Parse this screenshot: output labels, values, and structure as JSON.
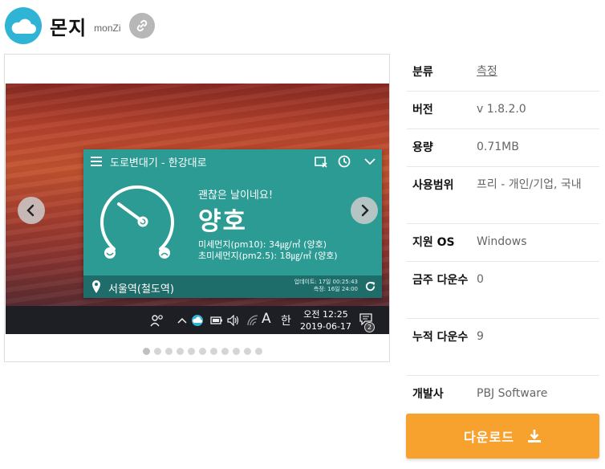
{
  "app": {
    "name": "몬지",
    "alt_name": "monZi"
  },
  "icons": {
    "logo": "cloud-logo-icon",
    "link": "link-icon",
    "prev": "chevron-left-icon",
    "next": "chevron-right-icon",
    "download": "download-icon"
  },
  "colors": {
    "accent": "#f7a12f",
    "logo_bg": "#2fb4d6",
    "widget_bg": "#2b9b94",
    "widget_bar": "#1f6d6a"
  },
  "screenshot": {
    "widget_title": "도로변대기 - 한강대로",
    "status_text": "괜찮은 날이네요!",
    "grade": "양호",
    "pm10": "미세먼지(pm10): 34㎍/㎥ (양호)",
    "pm25": "초미세먼지(pm2.5): 18㎍/㎥ (양호)",
    "station": "서울역(철도역)",
    "updated": "업데이트: 17일 00:25:43",
    "measured": "측정: 16일 24:00",
    "taskbar_a": "A",
    "taskbar_ime": "한",
    "clock_time": "오전 12:25",
    "clock_date": "2019-06-17",
    "notification_count": "2"
  },
  "gallery": {
    "slide_count": 11,
    "active_index": 0
  },
  "info": {
    "category_label": "분류",
    "category_value": "측정",
    "version_label": "버전",
    "version_value": "v 1.8.2.0",
    "size_label": "용량",
    "size_value": "0.71MB",
    "license_label": "사용범위",
    "license_value": "프리 - 개인/기업, 국내",
    "os_label": "지원 OS",
    "os_value": "Windows",
    "weekly_label": "금주 다운수",
    "weekly_value": "0",
    "total_label": "누적 다운수",
    "total_value": "9",
    "developer_label": "개발사",
    "developer_value": "PBJ Software"
  },
  "download": {
    "label": "다운로드"
  }
}
